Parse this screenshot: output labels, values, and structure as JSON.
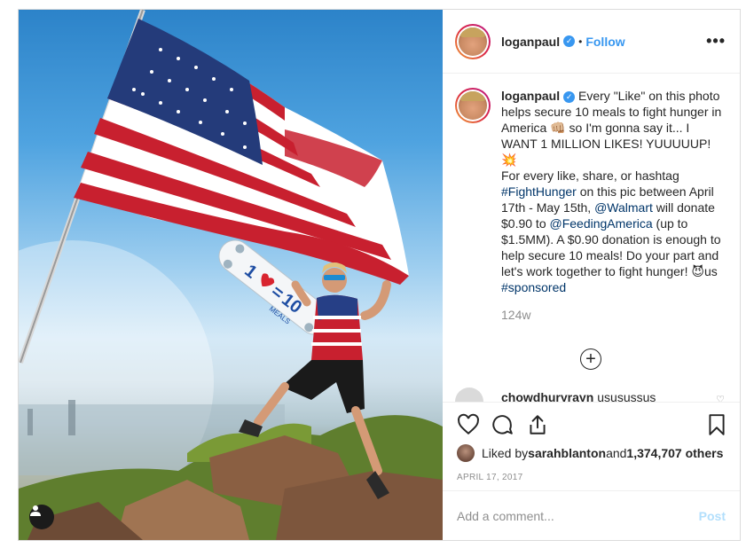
{
  "post": {
    "username": "loganpaul",
    "verified_glyph": "✓",
    "separator": "•",
    "follow_label": "Follow",
    "more_label": "•••",
    "caption": {
      "username": "loganpaul",
      "line1": " Every \"Like\" on this photo helps secure 10 meals to fight hunger in America 👊🏼 so I'm gonna say it... I WANT 1 MILLION LIKES! YUUUUUP! 💥",
      "line2_a": "For every like, share, or hashtag ",
      "hashtag1": "#FightHunger",
      "line2_b": " on this pic between April 17th - May 15th, ",
      "mention1": "@Walmart",
      "line2_c": " will donate $0.90 to ",
      "mention2": "@FeedingAmerica",
      "line2_d": " (up to $1.5MM). A $0.90 donation is enough to help secure 10 meals! Do your part and let's work together to fight hunger! 😈us ",
      "hashtag2": "#sponsored"
    },
    "time_ago": "124w",
    "load_more_label": "+",
    "comment_peek": {
      "username": "chowdhuryrayn",
      "text": "ususussus"
    },
    "likes": {
      "prefix": "Liked by ",
      "user": "sarahblanton",
      "middle": " and ",
      "count": "1,374,707 others"
    },
    "date": "APRIL 17, 2017",
    "add_comment_placeholder": "Add a comment...",
    "post_label": "Post",
    "photo_text": {
      "skate_top": "1",
      "skate_eq": "=",
      "skate_num": "10",
      "skate_meals": "MEALS"
    },
    "icons": {
      "like": "heart-icon",
      "comment": "comment-icon",
      "share": "share-icon",
      "save": "bookmark-icon",
      "tag": "user-tag-icon"
    },
    "colors": {
      "accent": "#3897f0",
      "link": "#003569",
      "muted": "#8e8e8e",
      "border": "#dbdbdb"
    }
  }
}
